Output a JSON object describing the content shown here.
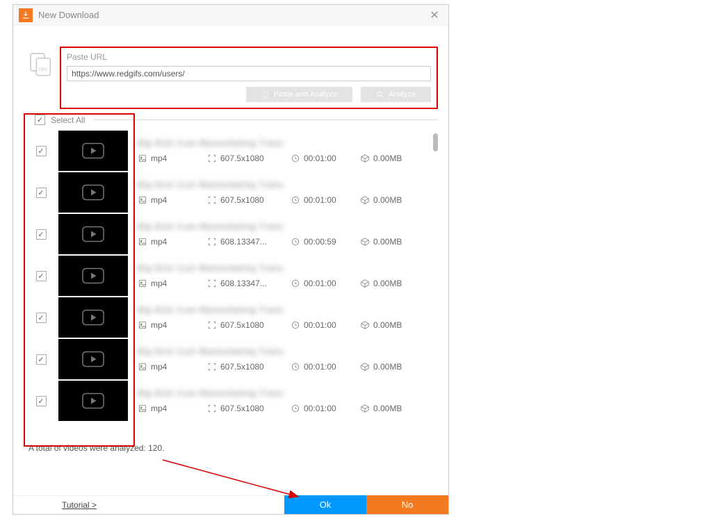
{
  "window": {
    "title": "New Download"
  },
  "url": {
    "legend": "Paste URL",
    "value": "https://www.redgifs.com/users/",
    "paste_btn": "Paste and Analyze",
    "analyze_btn": "Analyze"
  },
  "select_all_label": "Select All",
  "items": [
    {
      "fmt": "mp4",
      "res": "607.5x1080",
      "dur": "00:01:00",
      "size": "0.00MB"
    },
    {
      "fmt": "mp4",
      "res": "607.5x1080",
      "dur": "00:01:00",
      "size": "0.00MB"
    },
    {
      "fmt": "mp4",
      "res": "608.13347...",
      "dur": "00:00:59",
      "size": "0.00MB"
    },
    {
      "fmt": "mp4",
      "res": "608.13347...",
      "dur": "00:01:00",
      "size": "0.00MB"
    },
    {
      "fmt": "mp4",
      "res": "607.5x1080",
      "dur": "00:01:00",
      "size": "0.00MB"
    },
    {
      "fmt": "mp4",
      "res": "607.5x1080",
      "dur": "00:01:00",
      "size": "0.00MB"
    },
    {
      "fmt": "mp4",
      "res": "607.5x1080",
      "dur": "00:01:00",
      "size": "0.00MB"
    }
  ],
  "total_text": "A total of videos were analyzed: 120.",
  "footer": {
    "tutorial": "Tutorial >",
    "ok": "Ok",
    "no": "No"
  }
}
